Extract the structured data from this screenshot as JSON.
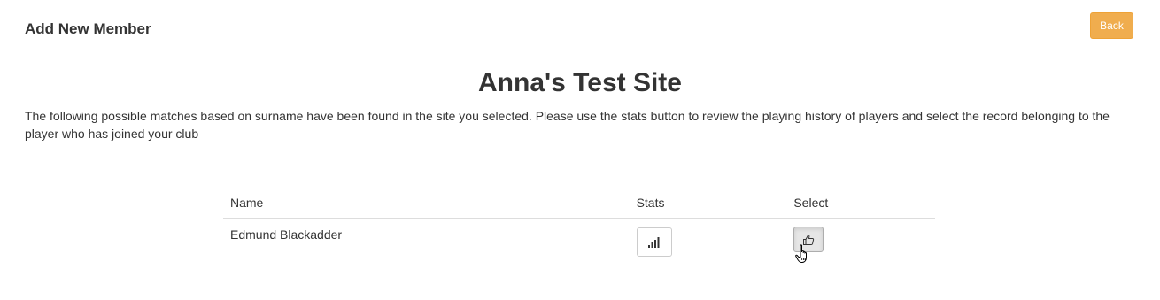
{
  "header": {
    "title": "Add New Member",
    "back_label": "Back"
  },
  "main": {
    "site_name": "Anna's Test Site",
    "intro": "The following possible matches based on surname have been found in the site you selected. Please use the stats button to review the playing history of players and select the record belonging to the player who has joined your club"
  },
  "table": {
    "columns": [
      "Name",
      "Stats",
      "Select"
    ],
    "rows": [
      {
        "name": "Edmund Blackadder",
        "stats_icon": "signal-bars-icon",
        "select_icon": "thumbs-up-icon"
      }
    ]
  },
  "colors": {
    "back_button": "#f0ad4e",
    "text": "#333333",
    "divider": "#dddddd"
  }
}
